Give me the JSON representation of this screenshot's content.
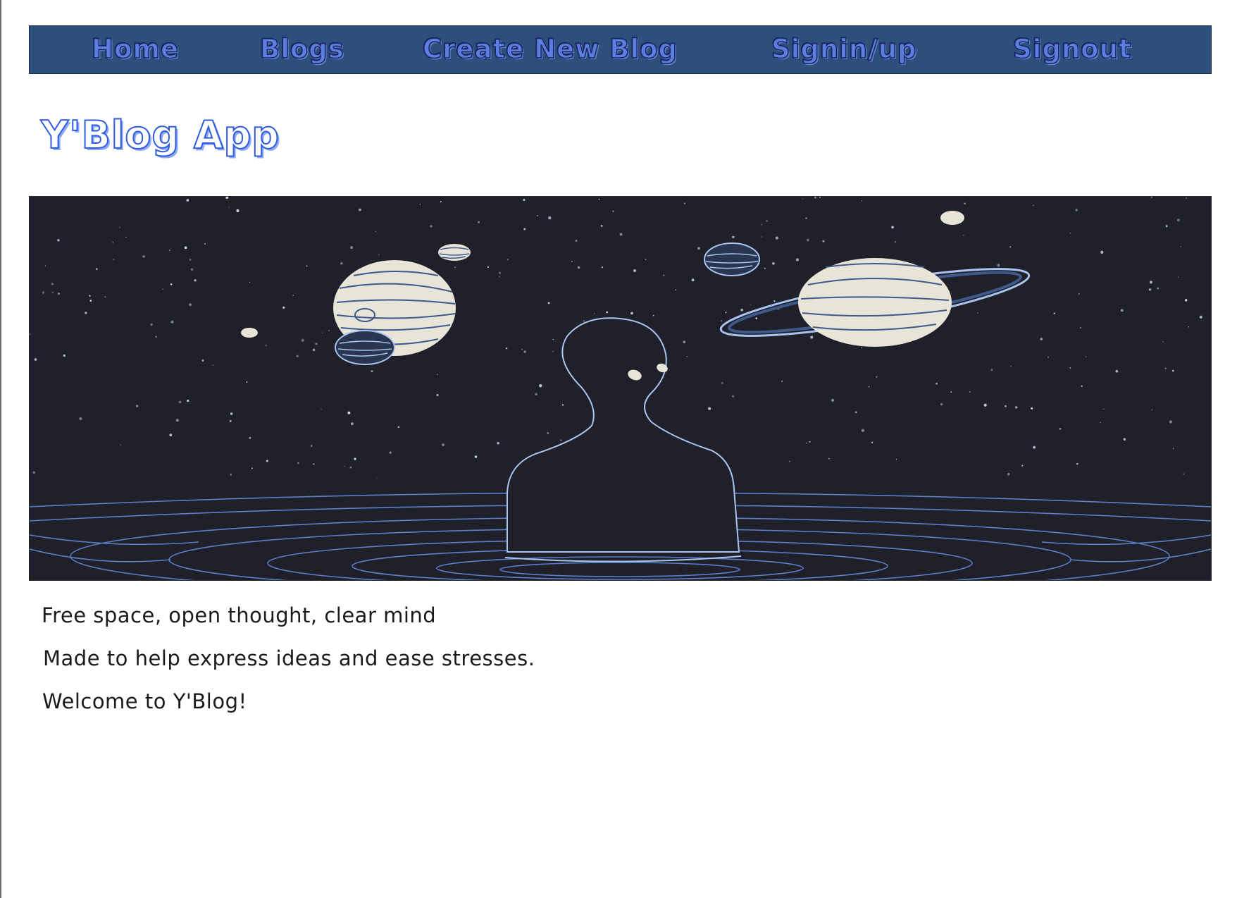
{
  "nav": {
    "items": [
      {
        "label": "Home"
      },
      {
        "label": "Blogs"
      },
      {
        "label": "Create New Blog"
      },
      {
        "label": "Signin/up"
      },
      {
        "label": "Signout"
      }
    ]
  },
  "header": {
    "title": "Y'Blog App"
  },
  "intro": {
    "line1": "Free space, open thought, clear mind",
    "line2": "Made to help express ideas and ease stresses.",
    "line3": "Welcome to Y'Blog!"
  },
  "colors": {
    "nav_background": "#2d4f7c",
    "title_accent": "#2f5be0",
    "hero_background": "#1f2029",
    "hero_line": "#a9c4f0",
    "planet_fill": "#e8e4d8"
  },
  "hero": {
    "icon": "astronaut-in-space-illustration"
  }
}
